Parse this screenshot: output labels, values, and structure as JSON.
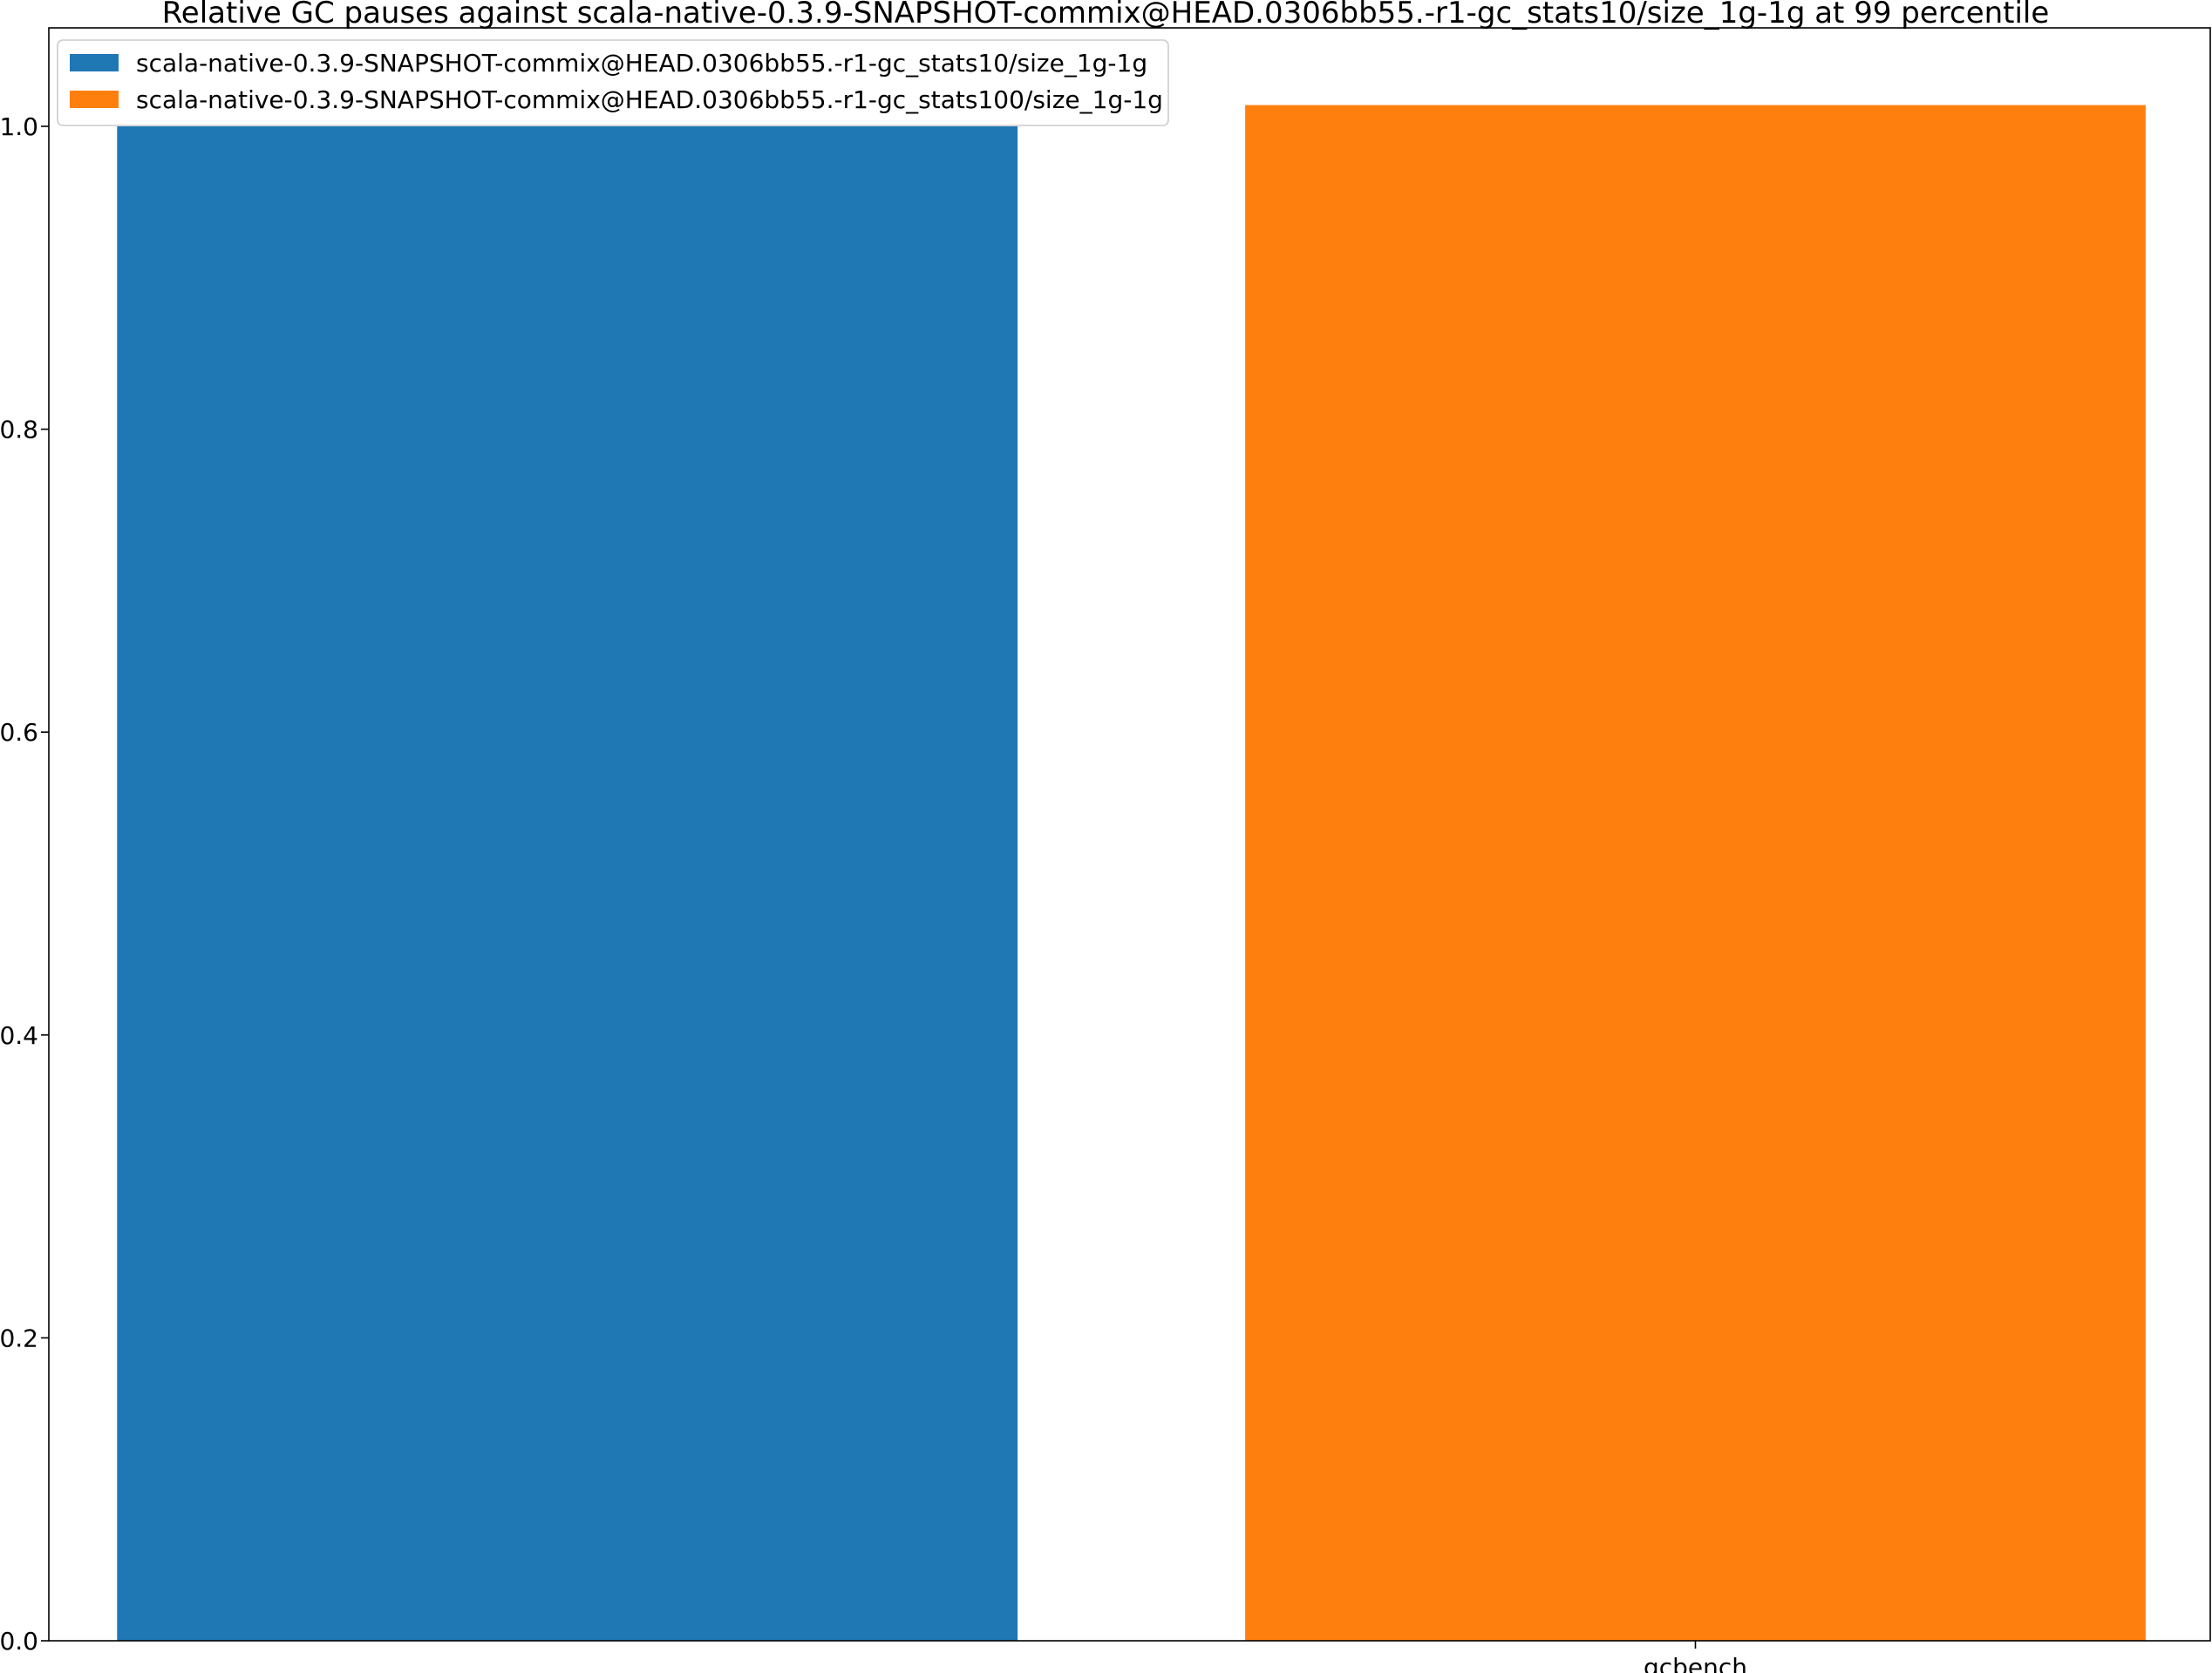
{
  "chart_data": {
    "type": "bar",
    "title": "Relative GC pauses against scala-native-0.3.9-SNAPSHOT-commix@HEAD.0306bb55.-r1-gc_stats10/size_1g-1g at 99 percentile",
    "xlabel": "",
    "ylabel": "",
    "categories": [
      "gcbench"
    ],
    "series": [
      {
        "name": "scala-native-0.3.9-SNAPSHOT-commix@HEAD.0306bb55.-r1-gc_stats10/size_1g-1g",
        "color": "#1f77b4",
        "values": [
          1.0
        ]
      },
      {
        "name": "scala-native-0.3.9-SNAPSHOT-commix@HEAD.0306bb55.-r1-gc_stats100/size_1g-1g",
        "color": "#ff7f0e",
        "values": [
          1.014
        ]
      }
    ],
    "ylim": [
      0,
      1.065
    ],
    "yticks": [
      0.0,
      0.2,
      0.4,
      0.6,
      0.8,
      1.0
    ],
    "ytick_labels": [
      "0.0",
      "0.2",
      "0.4",
      "0.6",
      "0.8",
      "1.0"
    ],
    "xtick_labels": [
      "gcbench"
    ],
    "grid": false,
    "legend_position": "top-left"
  }
}
